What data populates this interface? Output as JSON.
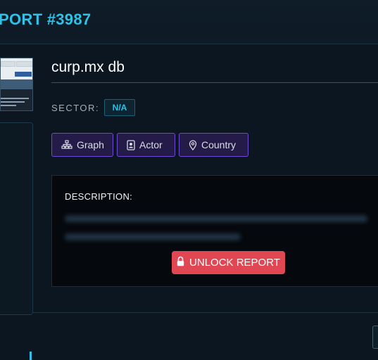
{
  "header": {
    "report_title": "PORT #3987"
  },
  "report": {
    "title": "curp.mx db",
    "sector_label": "SECTOR:",
    "sector_value": "N/A"
  },
  "tags": [
    {
      "label": "Graph",
      "icon": "sitemap-icon"
    },
    {
      "label": "Actor",
      "icon": "id-badge-icon"
    },
    {
      "label": "Country",
      "icon": "map-pin-icon"
    }
  ],
  "description": {
    "label": "DESCRIPTION:"
  },
  "unlock_button": {
    "label": "UNLOCK REPORT",
    "icon": "lock-icon"
  },
  "colors": {
    "accent": "#2fc2e6",
    "tag_border": "#6d4bd6",
    "tag_bg": "#241b48",
    "unlock_bg": "#e04753",
    "background": "#0c1620"
  }
}
